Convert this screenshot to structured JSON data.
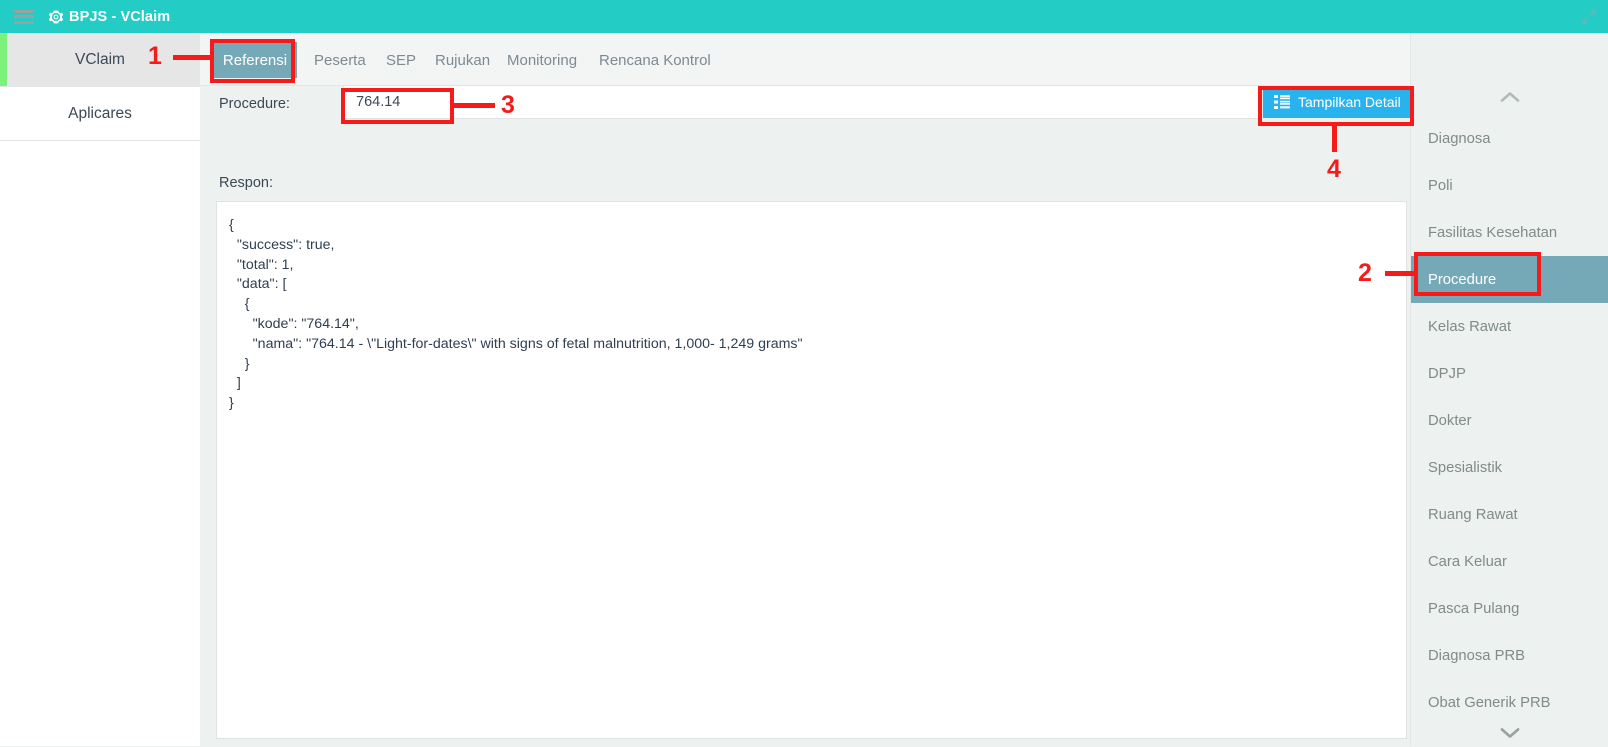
{
  "titlebar": {
    "title": "BPJS - VClaim",
    "menu_icon": "hamburger-icon",
    "app_icon": "gear-icon",
    "resize_icon": "resize-cursor-icon",
    "bg": "#23cdc6"
  },
  "left_rail": {
    "items": [
      {
        "label": "VClaim",
        "active": true
      },
      {
        "label": "Aplicares",
        "active": false
      }
    ],
    "active_accent": "#7cf27c"
  },
  "tabs": [
    {
      "label": "Referensi",
      "active": true
    },
    {
      "label": "Peserta",
      "active": false
    },
    {
      "label": "SEP",
      "active": false
    },
    {
      "label": "Rujukan",
      "active": false
    },
    {
      "label": "Monitoring",
      "active": false
    },
    {
      "label": "Rencana Kontrol",
      "active": false
    }
  ],
  "query": {
    "label": "Procedure:",
    "value": "764.14",
    "placeholder": "",
    "button_label": "Tampilkan Detail",
    "button_icon": "list-icon",
    "button_color": "#28b3ef"
  },
  "response": {
    "label": "Respon:",
    "body": "{\n  \"success\": true,\n  \"total\": 1,\n  \"data\": [\n    {\n      \"kode\": \"764.14\",\n      \"nama\": \"764.14 - \\\"Light-for-dates\\\" with signs of fetal malnutrition, 1,000- 1,249 grams\"\n    }\n  ]\n}"
  },
  "right_menu": {
    "collapse_up_icon": "chevron-up-icon",
    "collapse_down_icon": "chevron-down-icon",
    "active_color": "#76a9b8",
    "items": [
      {
        "label": "Diagnosa",
        "active": false
      },
      {
        "label": "Poli",
        "active": false
      },
      {
        "label": "Fasilitas Kesehatan",
        "active": false
      },
      {
        "label": "Procedure",
        "active": true
      },
      {
        "label": "Kelas Rawat",
        "active": false
      },
      {
        "label": "DPJP",
        "active": false
      },
      {
        "label": "Dokter",
        "active": false
      },
      {
        "label": "Spesialistik",
        "active": false
      },
      {
        "label": "Ruang Rawat",
        "active": false
      },
      {
        "label": "Cara Keluar",
        "active": false
      },
      {
        "label": "Pasca Pulang",
        "active": false
      },
      {
        "label": "Diagnosa PRB",
        "active": false
      },
      {
        "label": "Obat Generik PRB",
        "active": false
      }
    ]
  },
  "annotations": {
    "color": "#f51b1b",
    "markers": [
      {
        "num": "1",
        "target": "tab-referensi"
      },
      {
        "num": "2",
        "target": "right-menu-procedure"
      },
      {
        "num": "3",
        "target": "procedure-input"
      },
      {
        "num": "4",
        "target": "tampilkan-detail-button"
      }
    ]
  }
}
